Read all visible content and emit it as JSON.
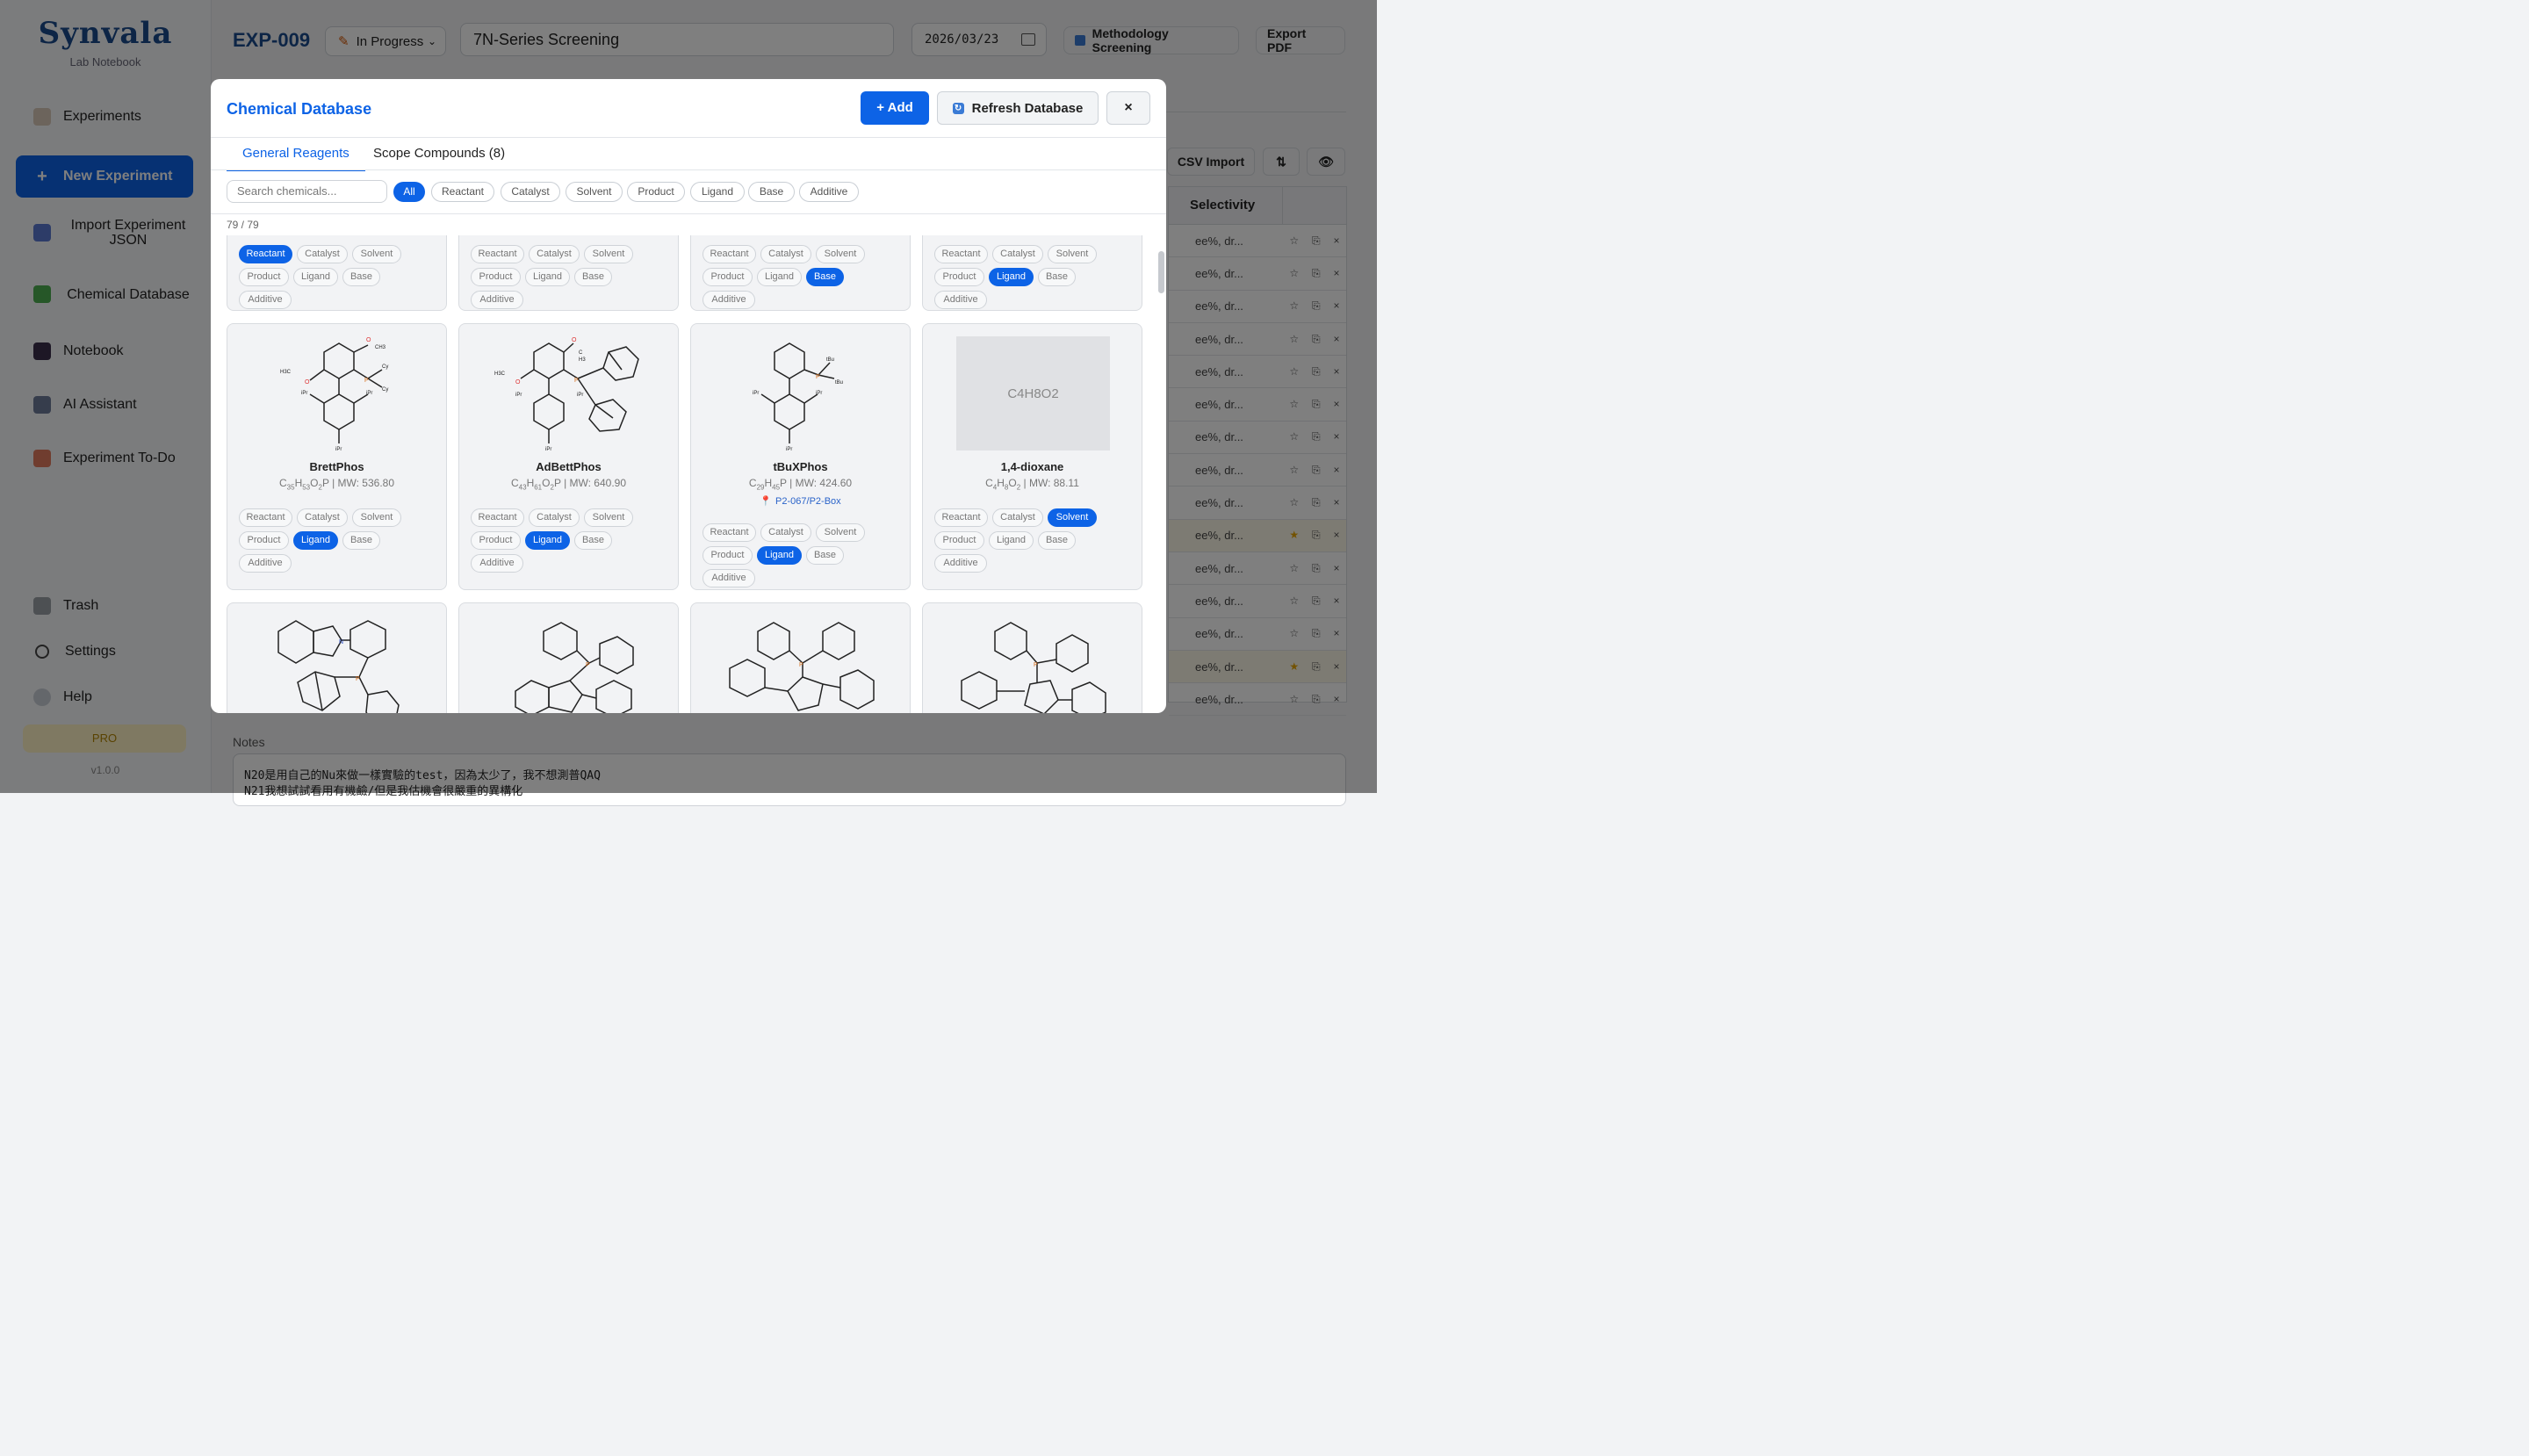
{
  "sidebar": {
    "brand": "Synvala",
    "subtitle": "Lab Notebook",
    "items": [
      {
        "label": "Experiments"
      },
      {
        "label": "New Experiment"
      },
      {
        "label": "Import Experiment JSON"
      },
      {
        "label": "Chemical Database"
      },
      {
        "label": "Notebook"
      },
      {
        "label": "AI Assistant"
      },
      {
        "label": "Experiment To-Do"
      },
      {
        "label": "Trash"
      },
      {
        "label": "Settings"
      },
      {
        "label": "Help"
      }
    ],
    "pro_label": "PRO",
    "version": "v1.0.0"
  },
  "header": {
    "exp_id": "EXP-009",
    "status": "In Progress",
    "title_value": "7N-Series Screening",
    "date": "2026/03/23",
    "category": "Methodology Screening",
    "export_label": "Export PDF"
  },
  "table": {
    "csv_import": "CSV Import",
    "sort_icon": "⇅",
    "column_selectivity": "Selectivity",
    "row_text": "ee%, dr...",
    "starred_rows": [
      9,
      13
    ],
    "row_count": 15
  },
  "notes": {
    "label": "Notes",
    "line1": "N20是用自己的Nu來做一樣實驗的test，因為太少了，我不想測普QAQ",
    "line2": "N21我想試試看用有機鹼/但是我估機會很嚴重的異構化"
  },
  "modal": {
    "title": "Chemical Database",
    "add_label": "+ Add",
    "refresh_label": "Refresh Database",
    "close_label": "×",
    "tabs": [
      "General Reagents",
      "Scope Compounds (8)"
    ],
    "search_placeholder": "Search chemicals...",
    "filters": [
      "All",
      "Reactant",
      "Catalyst",
      "Solvent",
      "Product",
      "Ligand",
      "Base",
      "Additive"
    ],
    "count": "79 / 79",
    "role_labels": [
      "Reactant",
      "Catalyst",
      "Solvent",
      "Product",
      "Ligand",
      "Base",
      "Additive"
    ],
    "top_row_roles": [
      "Reactant",
      "",
      "Base",
      "Ligand"
    ],
    "cards": [
      {
        "name": "BrettPhos",
        "formula_parts": [
          "C",
          "35",
          "H",
          "53",
          "O",
          "2",
          "P"
        ],
        "mw": "MW: 536.80",
        "role": "Ligand"
      },
      {
        "name": "AdBettPhos",
        "formula_parts": [
          "C",
          "43",
          "H",
          "61",
          "O",
          "2",
          "P"
        ],
        "mw": "MW: 640.90",
        "role": "Ligand"
      },
      {
        "name": "tBuXPhos",
        "formula_parts": [
          "C",
          "29",
          "H",
          "45",
          "P"
        ],
        "mw": "MW: 424.60",
        "role": "Ligand",
        "location": "P2-067/P2-Box"
      },
      {
        "name": "1,4-dioxane",
        "formula_parts": [
          "C",
          "4",
          "H",
          "8",
          "O",
          "2"
        ],
        "mw": "MW: 88.11",
        "role": "Solvent",
        "placeholder": "C4H8O2"
      }
    ]
  }
}
